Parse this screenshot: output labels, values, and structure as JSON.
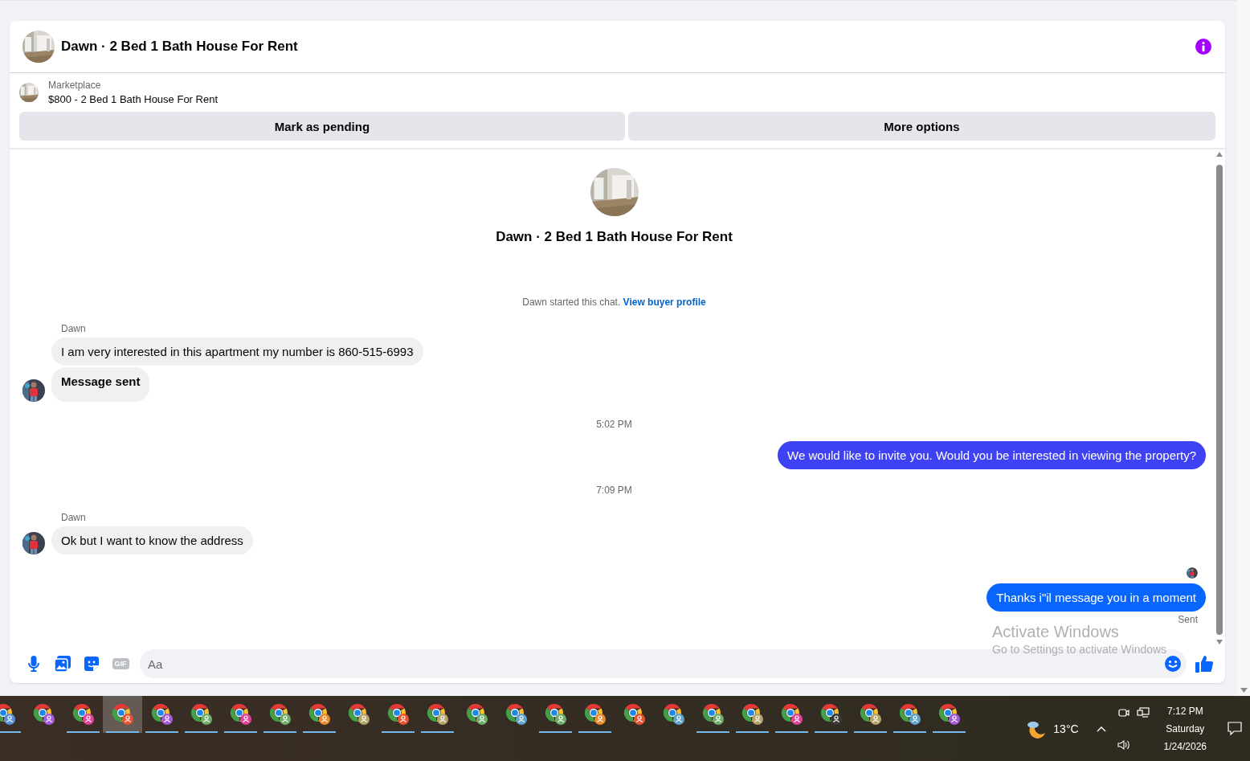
{
  "conversation": {
    "title": "Dawn · 2 Bed 1 Bath House For Rent",
    "listing": {
      "source": "Marketplace",
      "title": "$800 - 2 Bed 1 Bath House For Rent"
    },
    "actions": [
      "Mark as pending",
      "More options"
    ],
    "intro_title": "Dawn · 2 Bed 1 Bath House For Rent",
    "notice": {
      "text": "Dawn started this chat.",
      "link": "View buyer profile"
    },
    "messages": [
      {
        "kind": "sender",
        "text": "Dawn"
      },
      {
        "kind": "incoming",
        "text": "I am very interested in this apartment my number is 860-515-6993",
        "bold": false,
        "avatar": false
      },
      {
        "kind": "incoming",
        "text": "Message sent",
        "bold": true,
        "avatar": true
      },
      {
        "kind": "time",
        "text": "5:02 PM"
      },
      {
        "kind": "outgoing",
        "text": "We would like to invite you. Would you be interested in viewing the property?",
        "color": "#3f42f2"
      },
      {
        "kind": "time",
        "text": "7:09 PM"
      },
      {
        "kind": "sender",
        "text": "Dawn"
      },
      {
        "kind": "incoming",
        "text": "Ok but I want to know the address",
        "bold": false,
        "avatar": true
      },
      {
        "kind": "seen"
      },
      {
        "kind": "outgoing",
        "text": "Thanks i\"il message you in a moment",
        "color": "#0866ff"
      },
      {
        "kind": "status",
        "text": "Sent"
      }
    ],
    "composer": {
      "gif_label": "GIF",
      "placeholder": "Aa"
    }
  },
  "os_notice": {
    "title": "Activate Windows",
    "subtitle": "Go to Settings to activate Windows"
  },
  "taskbar": {
    "apps": [
      {
        "color": "#5b8fd6",
        "running": true,
        "selected": false
      },
      {
        "color": "#a55ad8",
        "running": false,
        "selected": false
      },
      {
        "color": "#e0439a",
        "running": true,
        "selected": false
      },
      {
        "color": "#e8542f",
        "running": true,
        "selected": true
      },
      {
        "color": "#a55ad8",
        "running": true,
        "selected": false
      },
      {
        "color": "#6fae6a",
        "running": true,
        "selected": false
      },
      {
        "color": "#e0439a",
        "running": true,
        "selected": false
      },
      {
        "color": "#6fae6a",
        "running": true,
        "selected": false
      },
      {
        "color": "#e98a2c",
        "running": true,
        "selected": false
      },
      {
        "color": "#b5a46a",
        "running": false,
        "selected": false
      },
      {
        "color": "#e8542f",
        "running": true,
        "selected": false
      },
      {
        "color": "#b5a46a",
        "running": true,
        "selected": false
      },
      {
        "color": "#6fae6a",
        "running": false,
        "selected": false
      },
      {
        "color": "#5ea3c9",
        "running": false,
        "selected": false
      },
      {
        "color": "#6fae6a",
        "running": true,
        "selected": false
      },
      {
        "color": "#e98a2c",
        "running": true,
        "selected": false
      },
      {
        "color": "#e8542f",
        "running": false,
        "selected": false
      },
      {
        "color": "#5ea3c9",
        "running": false,
        "selected": false
      },
      {
        "color": "#6fae6a",
        "running": true,
        "selected": false
      },
      {
        "color": "#b5a46a",
        "running": true,
        "selected": false
      },
      {
        "color": "#e0439a",
        "running": true,
        "selected": false
      },
      {
        "color": "#3a3a3a",
        "running": true,
        "selected": false
      },
      {
        "color": "#b5a46a",
        "running": true,
        "selected": false
      },
      {
        "color": "#5ea3c9",
        "running": true,
        "selected": false
      },
      {
        "color": "#a55ad8",
        "running": true,
        "selected": false
      }
    ],
    "temperature": "13°C",
    "time": "7:12 PM",
    "day": "Saturday",
    "date": "1/24/2026"
  }
}
